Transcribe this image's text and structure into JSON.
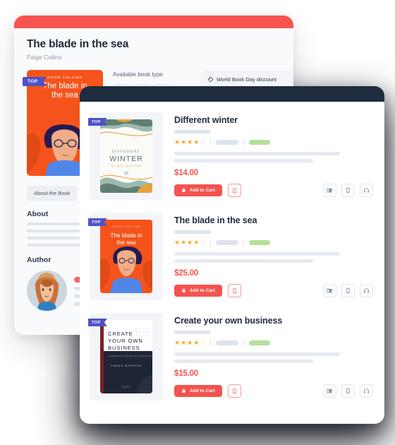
{
  "back_panel": {
    "title": "The blade in the sea",
    "author": "Paige Collins",
    "cover": {
      "badge": "TOP",
      "author_line": "PAIGE COLLINS",
      "title_line": "The blade in\nthe sea"
    },
    "book_type_label": "Available book type",
    "book_types": [
      {
        "name": "paperback-icon",
        "label": "Paperback"
      },
      {
        "name": "ebook-icon",
        "label": "E-book"
      },
      {
        "name": "audiobook-icon",
        "label": "Audiobook"
      }
    ],
    "promo": {
      "icon": "tag-icon",
      "text": "World Book Day discount"
    },
    "tab": "About the Book",
    "about_heading": "About",
    "author_heading": "Author"
  },
  "front_panel": {
    "items": [
      {
        "badge": "TOP",
        "title": "Different winter",
        "price": "$14.00",
        "rating": 4,
        "rating_max": 5,
        "cart_label": "Add to Cart",
        "cover": {
          "author_line": "BY MIA JACKSON",
          "title_top": "DIFFERENT",
          "title_main": "WINTER",
          "footer": "MIA JACKSON"
        }
      },
      {
        "badge": "TOP",
        "title": "The blade in the sea",
        "price": "$25.00",
        "rating": 4,
        "rating_max": 5,
        "cart_label": "Add to Cart",
        "cover": {
          "author_line": "PAIGE COLLINS",
          "title_top": "The blade in",
          "title_main": "the sea",
          "footer": ""
        }
      },
      {
        "badge": "TOP",
        "title": "Create your own business",
        "price": "$15.00",
        "rating": 4,
        "rating_max": 5,
        "cart_label": "Add to Cart",
        "cover": {
          "author_line": "JAMES MURDOR",
          "title_top": "CREATE YOUR OWN",
          "title_main": "BUSINESS",
          "footer": "BAPS"
        }
      }
    ],
    "formats": [
      {
        "name": "paperback-icon",
        "label": "Paperback"
      },
      {
        "name": "ebook-icon",
        "label": "E-book"
      },
      {
        "name": "audiobook-icon",
        "label": "Audiobook"
      }
    ],
    "bookmark_label": "Bookmark",
    "star_filled": "★",
    "star_empty": "☆"
  },
  "colors": {
    "accent_red": "#F3534F",
    "header_red": "#F7544F",
    "header_navy": "#1F2B3E",
    "badge_blue": "#4E52C8",
    "star_gold": "#F7A52B",
    "chip_green": "#B4E09A",
    "orange_cover": "#F4541C"
  }
}
